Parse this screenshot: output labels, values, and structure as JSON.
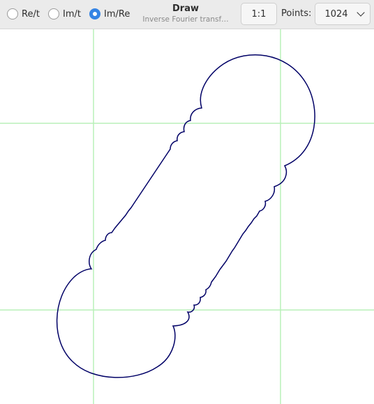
{
  "toolbar": {
    "modes": [
      {
        "label": "Re/t",
        "selected": false
      },
      {
        "label": "Im/t",
        "selected": false
      },
      {
        "label": "Im/Re",
        "selected": true
      }
    ],
    "title": "Draw",
    "subtitle": "Inverse Fourier transf…",
    "aspect_button": "1:1",
    "points_label": "Points:",
    "points_value": "1024"
  },
  "colors": {
    "curve": "#000066",
    "grid": "#b8f0b8",
    "accent": "#3584e4"
  }
}
